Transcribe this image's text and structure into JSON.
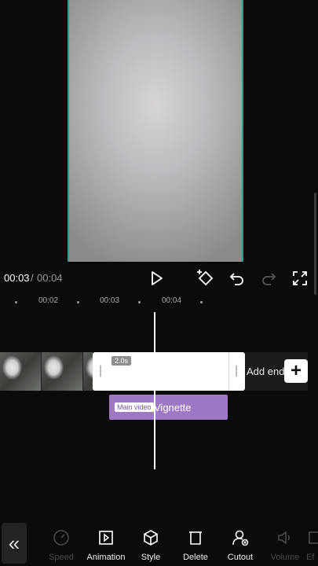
{
  "playback": {
    "current_time": "00:03",
    "separator": "/",
    "total_time": "00:04"
  },
  "controls": {
    "play_icon": "play-icon",
    "keyframe_icon": "keyframe-add-icon",
    "undo_icon": "undo-icon",
    "redo_icon": "redo-icon",
    "fullscreen_icon": "fullscreen-icon"
  },
  "ruler": {
    "labels": [
      "00:02",
      "00:03",
      "00:04"
    ]
  },
  "timeline": {
    "clip_duration": "2.0s",
    "add_ending_label": "Add ending",
    "add_clip_symbol": "+",
    "effect_badge": "Main video",
    "effect_name": "Vignette"
  },
  "toolbar": {
    "back_symbol": "«",
    "items": [
      {
        "label": "Speed",
        "icon": "speed-icon",
        "enabled": false
      },
      {
        "label": "Animation",
        "icon": "animation-icon",
        "enabled": true
      },
      {
        "label": "Style",
        "icon": "style-cube-icon",
        "enabled": true
      },
      {
        "label": "Delete",
        "icon": "delete-icon",
        "enabled": true
      },
      {
        "label": "Cutout",
        "icon": "cutout-icon",
        "enabled": true
      },
      {
        "label": "Volume",
        "icon": "volume-icon",
        "enabled": false
      },
      {
        "label": "Ef",
        "icon": "effect-icon",
        "enabled": false
      }
    ]
  },
  "colors": {
    "accent_teal": "#2f9b8f",
    "effect_purple": "#9f78c5"
  }
}
